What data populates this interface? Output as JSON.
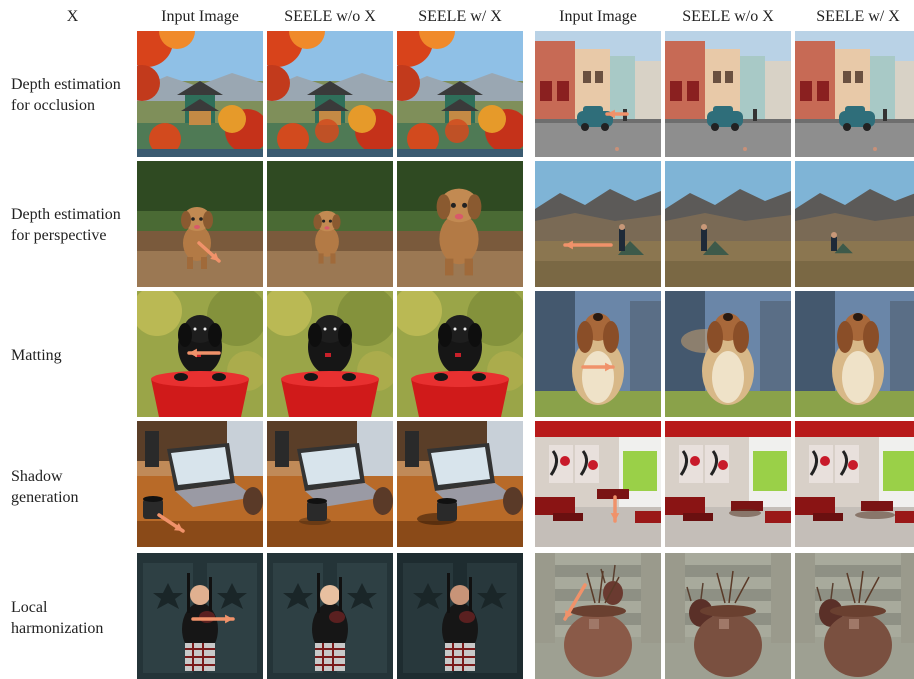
{
  "header": {
    "x_label": "X",
    "left_columns": [
      "Input Image",
      "SEELE w/o X",
      "SEELE w/ X"
    ],
    "right_columns": [
      "Input Image",
      "SEELE w/o X",
      "SEELE w/ X"
    ]
  },
  "rows": [
    {
      "label": "Depth estimation\nfor occlusion",
      "left_scene": "pagoda-autumn",
      "right_scene": "street-vintage-car"
    },
    {
      "label": "Depth estimation\nfor perspective",
      "left_scene": "running-dog",
      "right_scene": "tent-mountains"
    },
    {
      "label": "Matting",
      "left_scene": "black-dog-bucket",
      "right_scene": "fluffy-dog"
    },
    {
      "label": "Shadow\ngeneration",
      "left_scene": "laptop-desk-mug",
      "right_scene": "red-living-room"
    },
    {
      "label": "Local\nharmonization",
      "left_scene": "bagpiper-door",
      "right_scene": "clay-pot-stairs"
    }
  ],
  "colors": {
    "arrow": "#f0926a"
  }
}
